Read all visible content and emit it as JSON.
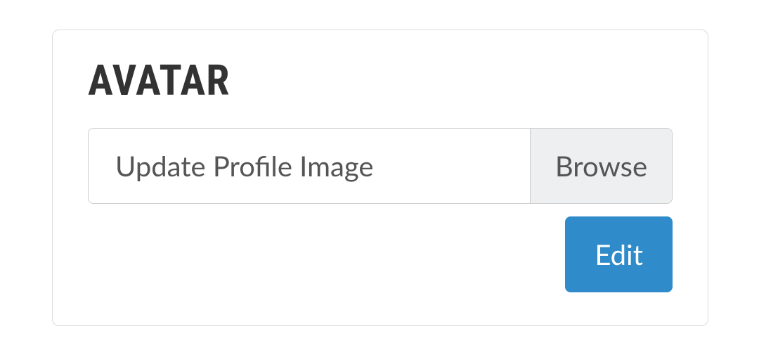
{
  "avatar": {
    "title": "AVATAR",
    "file_placeholder": "Update Profile Image",
    "browse_label": "Browse",
    "edit_label": "Edit"
  }
}
